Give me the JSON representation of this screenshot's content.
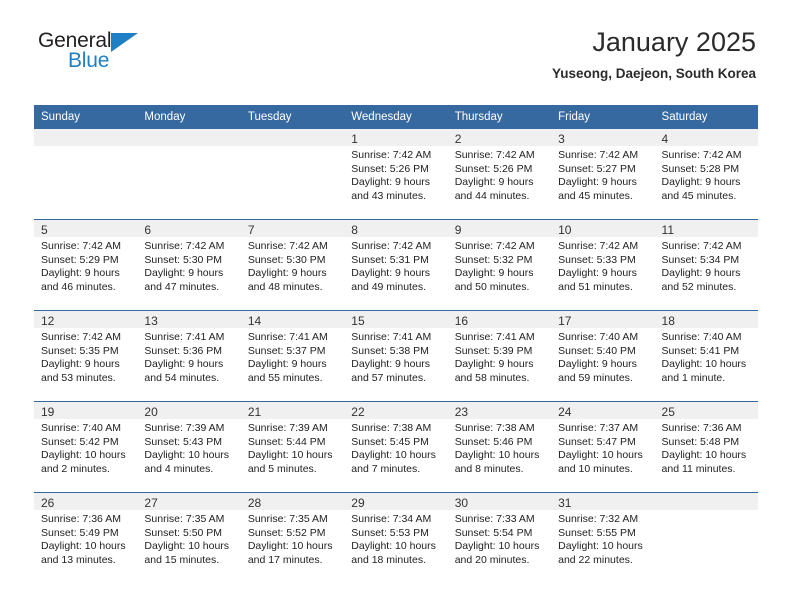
{
  "brand": {
    "name_top": "General",
    "name_bottom": "Blue",
    "triangle_color": "#1f7fc4"
  },
  "header": {
    "title": "January 2025",
    "subtitle": "Yuseong, Daejeon, South Korea"
  },
  "theme": {
    "header_blue": "#36699f",
    "daynum_bg": "#f0f0f0",
    "text": "#222222"
  },
  "weekday_headers": [
    "Sunday",
    "Monday",
    "Tuesday",
    "Wednesday",
    "Thursday",
    "Friday",
    "Saturday"
  ],
  "labels": {
    "sunrise_prefix": "Sunrise:",
    "sunset_prefix": "Sunset:",
    "daylight_prefix": "Daylight:"
  },
  "weeks": [
    [
      {
        "day": "",
        "blank": true,
        "sunrise": "",
        "sunset": "",
        "daylight_1": "",
        "daylight_2": ""
      },
      {
        "day": "",
        "blank": true,
        "sunrise": "",
        "sunset": "",
        "daylight_1": "",
        "daylight_2": ""
      },
      {
        "day": "",
        "blank": true,
        "sunrise": "",
        "sunset": "",
        "daylight_1": "",
        "daylight_2": ""
      },
      {
        "day": "1",
        "blank": false,
        "sunrise": "Sunrise: 7:42 AM",
        "sunset": "Sunset: 5:26 PM",
        "daylight_1": "Daylight: 9 hours",
        "daylight_2": "and 43 minutes."
      },
      {
        "day": "2",
        "blank": false,
        "sunrise": "Sunrise: 7:42 AM",
        "sunset": "Sunset: 5:26 PM",
        "daylight_1": "Daylight: 9 hours",
        "daylight_2": "and 44 minutes."
      },
      {
        "day": "3",
        "blank": false,
        "sunrise": "Sunrise: 7:42 AM",
        "sunset": "Sunset: 5:27 PM",
        "daylight_1": "Daylight: 9 hours",
        "daylight_2": "and 45 minutes."
      },
      {
        "day": "4",
        "blank": false,
        "sunrise": "Sunrise: 7:42 AM",
        "sunset": "Sunset: 5:28 PM",
        "daylight_1": "Daylight: 9 hours",
        "daylight_2": "and 45 minutes."
      }
    ],
    [
      {
        "day": "5",
        "blank": false,
        "sunrise": "Sunrise: 7:42 AM",
        "sunset": "Sunset: 5:29 PM",
        "daylight_1": "Daylight: 9 hours",
        "daylight_2": "and 46 minutes."
      },
      {
        "day": "6",
        "blank": false,
        "sunrise": "Sunrise: 7:42 AM",
        "sunset": "Sunset: 5:30 PM",
        "daylight_1": "Daylight: 9 hours",
        "daylight_2": "and 47 minutes."
      },
      {
        "day": "7",
        "blank": false,
        "sunrise": "Sunrise: 7:42 AM",
        "sunset": "Sunset: 5:30 PM",
        "daylight_1": "Daylight: 9 hours",
        "daylight_2": "and 48 minutes."
      },
      {
        "day": "8",
        "blank": false,
        "sunrise": "Sunrise: 7:42 AM",
        "sunset": "Sunset: 5:31 PM",
        "daylight_1": "Daylight: 9 hours",
        "daylight_2": "and 49 minutes."
      },
      {
        "day": "9",
        "blank": false,
        "sunrise": "Sunrise: 7:42 AM",
        "sunset": "Sunset: 5:32 PM",
        "daylight_1": "Daylight: 9 hours",
        "daylight_2": "and 50 minutes."
      },
      {
        "day": "10",
        "blank": false,
        "sunrise": "Sunrise: 7:42 AM",
        "sunset": "Sunset: 5:33 PM",
        "daylight_1": "Daylight: 9 hours",
        "daylight_2": "and 51 minutes."
      },
      {
        "day": "11",
        "blank": false,
        "sunrise": "Sunrise: 7:42 AM",
        "sunset": "Sunset: 5:34 PM",
        "daylight_1": "Daylight: 9 hours",
        "daylight_2": "and 52 minutes."
      }
    ],
    [
      {
        "day": "12",
        "blank": false,
        "sunrise": "Sunrise: 7:42 AM",
        "sunset": "Sunset: 5:35 PM",
        "daylight_1": "Daylight: 9 hours",
        "daylight_2": "and 53 minutes."
      },
      {
        "day": "13",
        "blank": false,
        "sunrise": "Sunrise: 7:41 AM",
        "sunset": "Sunset: 5:36 PM",
        "daylight_1": "Daylight: 9 hours",
        "daylight_2": "and 54 minutes."
      },
      {
        "day": "14",
        "blank": false,
        "sunrise": "Sunrise: 7:41 AM",
        "sunset": "Sunset: 5:37 PM",
        "daylight_1": "Daylight: 9 hours",
        "daylight_2": "and 55 minutes."
      },
      {
        "day": "15",
        "blank": false,
        "sunrise": "Sunrise: 7:41 AM",
        "sunset": "Sunset: 5:38 PM",
        "daylight_1": "Daylight: 9 hours",
        "daylight_2": "and 57 minutes."
      },
      {
        "day": "16",
        "blank": false,
        "sunrise": "Sunrise: 7:41 AM",
        "sunset": "Sunset: 5:39 PM",
        "daylight_1": "Daylight: 9 hours",
        "daylight_2": "and 58 minutes."
      },
      {
        "day": "17",
        "blank": false,
        "sunrise": "Sunrise: 7:40 AM",
        "sunset": "Sunset: 5:40 PM",
        "daylight_1": "Daylight: 9 hours",
        "daylight_2": "and 59 minutes."
      },
      {
        "day": "18",
        "blank": false,
        "sunrise": "Sunrise: 7:40 AM",
        "sunset": "Sunset: 5:41 PM",
        "daylight_1": "Daylight: 10 hours",
        "daylight_2": "and 1 minute."
      }
    ],
    [
      {
        "day": "19",
        "blank": false,
        "sunrise": "Sunrise: 7:40 AM",
        "sunset": "Sunset: 5:42 PM",
        "daylight_1": "Daylight: 10 hours",
        "daylight_2": "and 2 minutes."
      },
      {
        "day": "20",
        "blank": false,
        "sunrise": "Sunrise: 7:39 AM",
        "sunset": "Sunset: 5:43 PM",
        "daylight_1": "Daylight: 10 hours",
        "daylight_2": "and 4 minutes."
      },
      {
        "day": "21",
        "blank": false,
        "sunrise": "Sunrise: 7:39 AM",
        "sunset": "Sunset: 5:44 PM",
        "daylight_1": "Daylight: 10 hours",
        "daylight_2": "and 5 minutes."
      },
      {
        "day": "22",
        "blank": false,
        "sunrise": "Sunrise: 7:38 AM",
        "sunset": "Sunset: 5:45 PM",
        "daylight_1": "Daylight: 10 hours",
        "daylight_2": "and 7 minutes."
      },
      {
        "day": "23",
        "blank": false,
        "sunrise": "Sunrise: 7:38 AM",
        "sunset": "Sunset: 5:46 PM",
        "daylight_1": "Daylight: 10 hours",
        "daylight_2": "and 8 minutes."
      },
      {
        "day": "24",
        "blank": false,
        "sunrise": "Sunrise: 7:37 AM",
        "sunset": "Sunset: 5:47 PM",
        "daylight_1": "Daylight: 10 hours",
        "daylight_2": "and 10 minutes."
      },
      {
        "day": "25",
        "blank": false,
        "sunrise": "Sunrise: 7:36 AM",
        "sunset": "Sunset: 5:48 PM",
        "daylight_1": "Daylight: 10 hours",
        "daylight_2": "and 11 minutes."
      }
    ],
    [
      {
        "day": "26",
        "blank": false,
        "sunrise": "Sunrise: 7:36 AM",
        "sunset": "Sunset: 5:49 PM",
        "daylight_1": "Daylight: 10 hours",
        "daylight_2": "and 13 minutes."
      },
      {
        "day": "27",
        "blank": false,
        "sunrise": "Sunrise: 7:35 AM",
        "sunset": "Sunset: 5:50 PM",
        "daylight_1": "Daylight: 10 hours",
        "daylight_2": "and 15 minutes."
      },
      {
        "day": "28",
        "blank": false,
        "sunrise": "Sunrise: 7:35 AM",
        "sunset": "Sunset: 5:52 PM",
        "daylight_1": "Daylight: 10 hours",
        "daylight_2": "and 17 minutes."
      },
      {
        "day": "29",
        "blank": false,
        "sunrise": "Sunrise: 7:34 AM",
        "sunset": "Sunset: 5:53 PM",
        "daylight_1": "Daylight: 10 hours",
        "daylight_2": "and 18 minutes."
      },
      {
        "day": "30",
        "blank": false,
        "sunrise": "Sunrise: 7:33 AM",
        "sunset": "Sunset: 5:54 PM",
        "daylight_1": "Daylight: 10 hours",
        "daylight_2": "and 20 minutes."
      },
      {
        "day": "31",
        "blank": false,
        "sunrise": "Sunrise: 7:32 AM",
        "sunset": "Sunset: 5:55 PM",
        "daylight_1": "Daylight: 10 hours",
        "daylight_2": "and 22 minutes."
      },
      {
        "day": "",
        "blank": true,
        "sunrise": "",
        "sunset": "",
        "daylight_1": "",
        "daylight_2": ""
      }
    ]
  ]
}
